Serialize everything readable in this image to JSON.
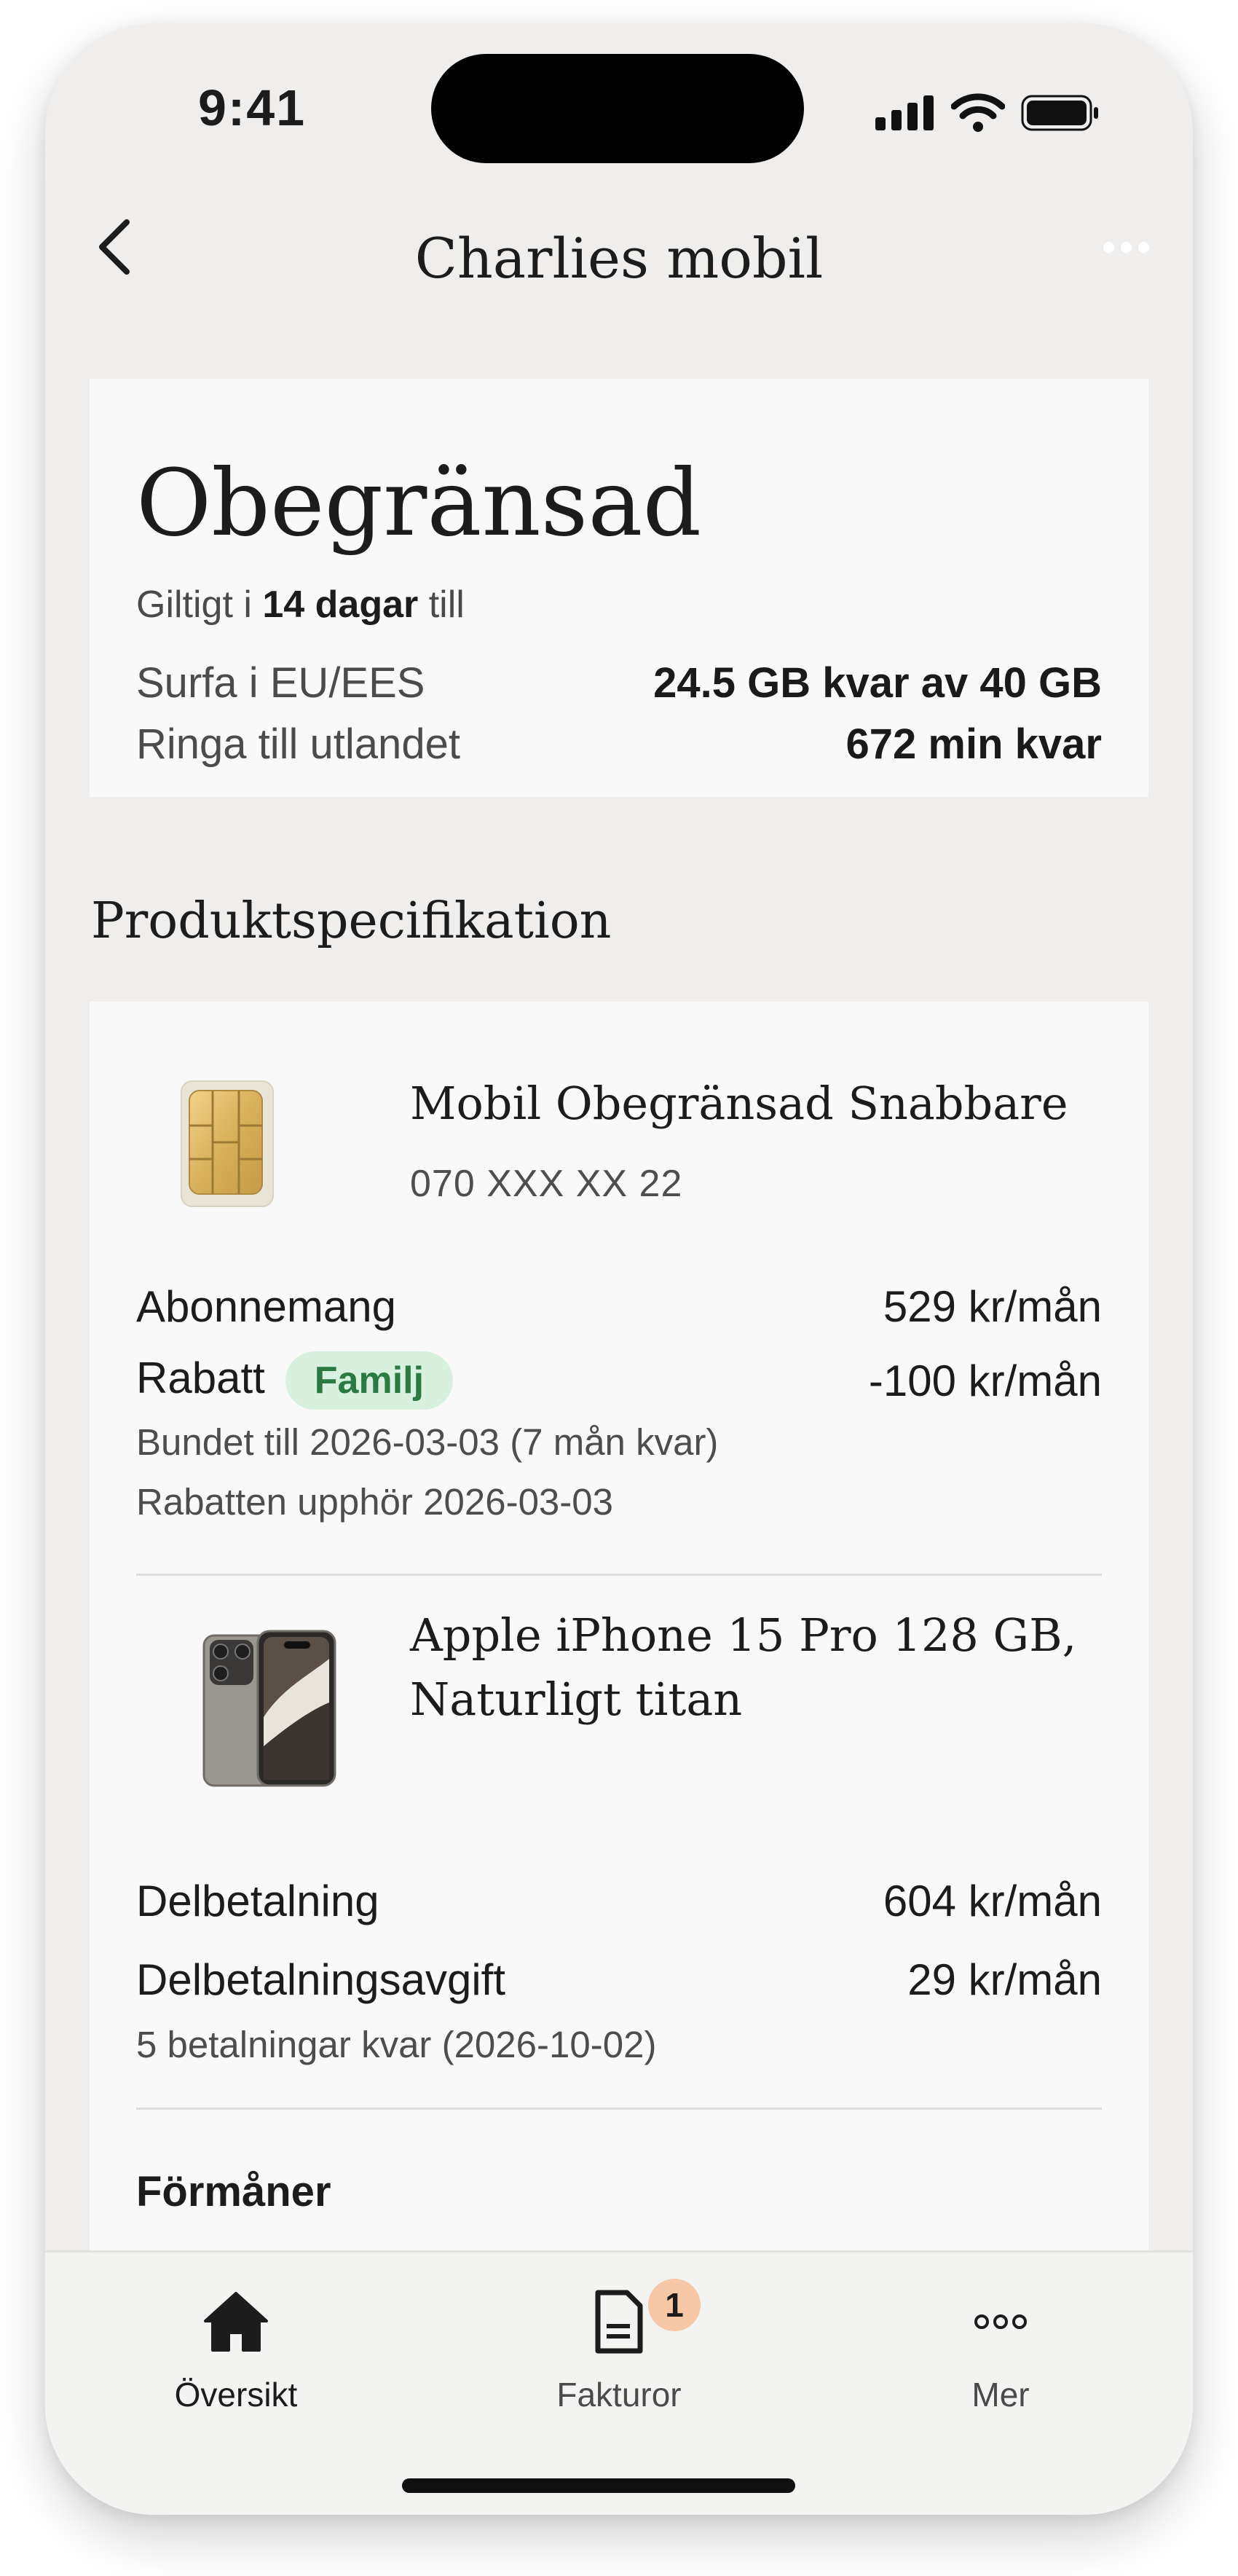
{
  "status": {
    "time": "9:41"
  },
  "header": {
    "title": "Charlies mobil"
  },
  "plan": {
    "name": "Obegränsad",
    "validity_prefix": "Giltigt i",
    "validity_days": "14 dagar",
    "validity_suffix": "till",
    "rows": [
      {
        "label": "Surfa i EU/EES",
        "value": "24.5 GB kvar av 40 GB"
      },
      {
        "label": "Ringa till utlandet",
        "value": "672 min kvar"
      }
    ]
  },
  "spec": {
    "title": "Produktspecifikation",
    "subscription": {
      "name": "Mobil Obegränsad Snabbare",
      "number": "070 XXX XX 22",
      "lines": [
        {
          "label": "Abonnemang",
          "value": "529 kr/mån"
        },
        {
          "label": "Rabatt",
          "tag": "Familj",
          "value": "-100 kr/mån"
        }
      ],
      "notes": [
        "Bundet till 2026-03-03 (7 mån kvar)",
        "Rabatten upphör 2026-03-03"
      ]
    },
    "device": {
      "name_line1": "Apple iPhone 15 Pro 128 GB,",
      "name_line2": "Naturligt titan",
      "lines": [
        {
          "label": "Delbetalning",
          "value": "604 kr/mån"
        },
        {
          "label": "Delbetalningsavgift",
          "value": "29 kr/mån"
        }
      ],
      "note": "5 betalningar kvar (2026-10-02)"
    },
    "next_section_partial": "Förmåner"
  },
  "tabbar": {
    "items": [
      {
        "label": "Översikt",
        "icon": "home-icon"
      },
      {
        "label": "Fakturor",
        "icon": "invoice-icon",
        "badge": "1"
      },
      {
        "label": "Mer",
        "icon": "more-icon"
      }
    ]
  },
  "colors": {
    "background": "#efeeec",
    "card": "#f9f9f9",
    "tag_bg": "#d8f1de",
    "tag_text": "#2a7a42",
    "badge": "#f7c7a6"
  }
}
